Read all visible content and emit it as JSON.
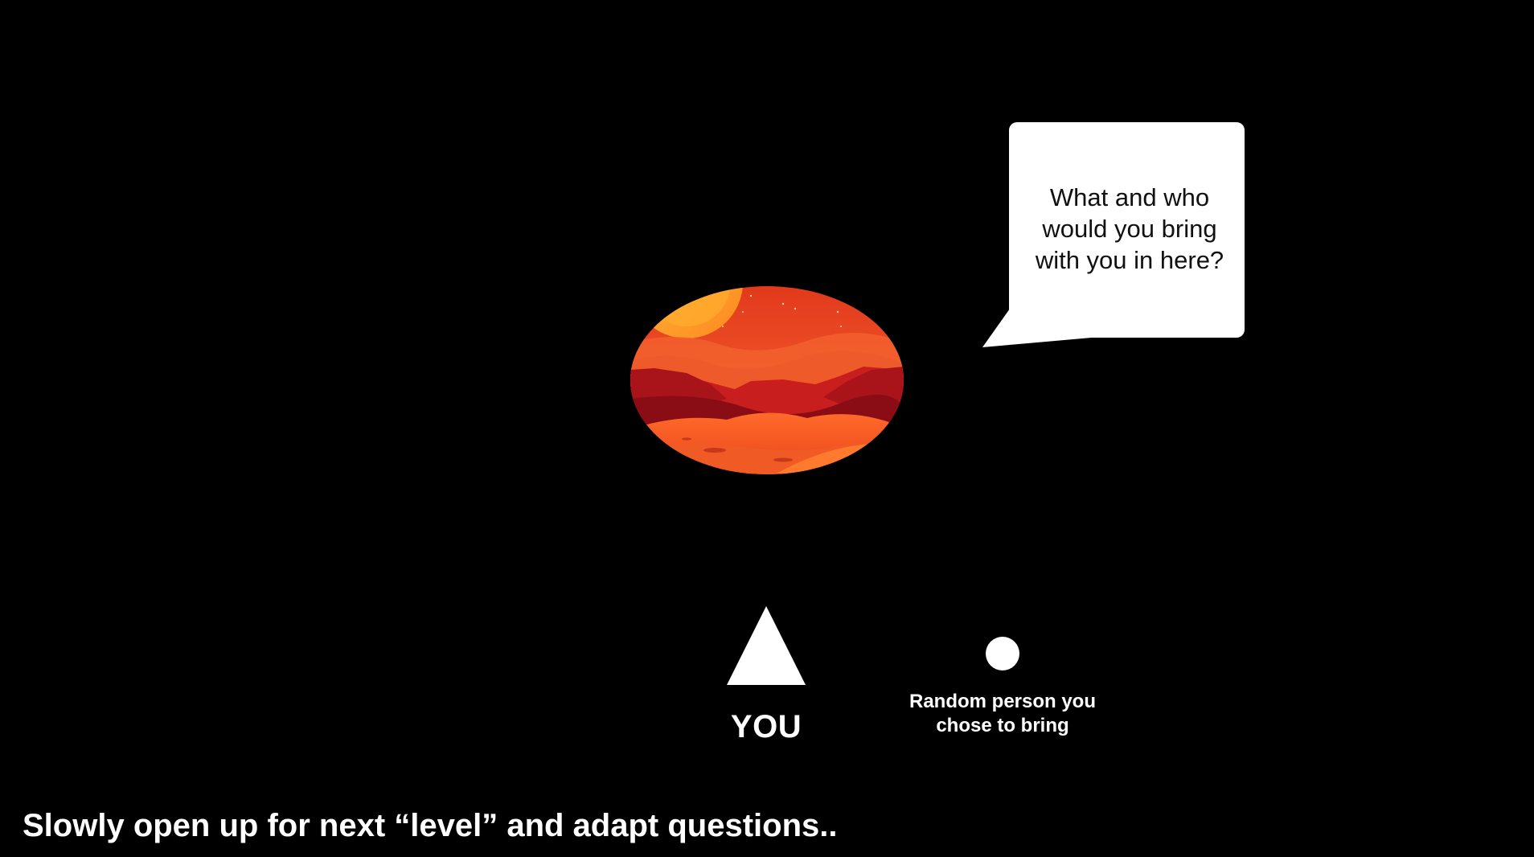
{
  "slide": {
    "background": "#000000",
    "bubble": {
      "text": "What and who\nwould you bring\nwith you in here?",
      "fill": "#ffffff",
      "text_color": "#111111"
    },
    "planet": {
      "icon": "mars-landscape-illustration",
      "palette": [
        "#f25a2a",
        "#e8431f",
        "#b8161a",
        "#7d0a12",
        "#ffa726"
      ]
    },
    "you": {
      "icon": "triangle-shape",
      "label": "YOU"
    },
    "companion": {
      "icon": "circle-shape",
      "label": "Random person you\nchose to bring"
    },
    "note": "Slowly open up for next “level” and adapt questions.."
  }
}
